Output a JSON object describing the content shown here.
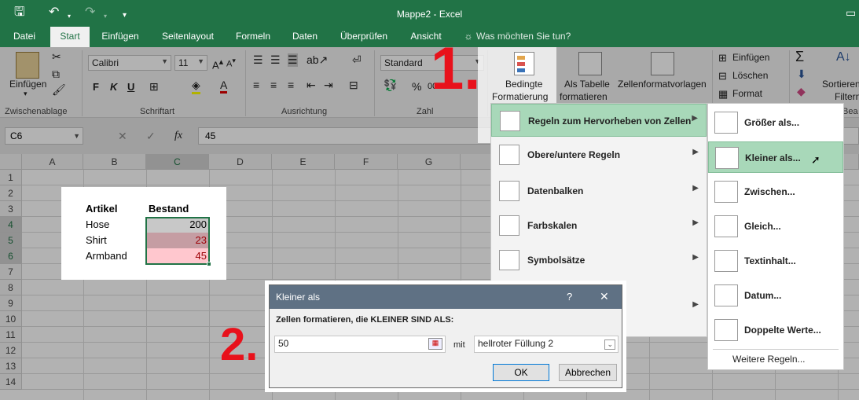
{
  "titlebar": {
    "title": "Mappe2 - Excel"
  },
  "tabs": [
    "Datei",
    "Start",
    "Einfügen",
    "Seitenlayout",
    "Formeln",
    "Daten",
    "Überprüfen",
    "Ansicht"
  ],
  "tell_me": "Was möchten Sie tun?",
  "clipboard": {
    "paste": "Einfügen",
    "label": "Zwischenablage"
  },
  "font": {
    "name": "Calibri",
    "size": "11",
    "bold": "F",
    "italic": "K",
    "underline": "U",
    "label": "Schriftart"
  },
  "alignment": {
    "label": "Ausrichtung"
  },
  "number": {
    "format": "Standard",
    "percent": "%",
    "thousands": "000",
    "label": "Zahl"
  },
  "styles": {
    "conditional_line1": "Bedingte",
    "conditional_line2": "Formatierung",
    "table_line1": "Als Tabelle",
    "table_line2": "formatieren",
    "cellstyles": "Zellenformatvorlagen"
  },
  "cells": {
    "insert": "Einfügen",
    "delete": "Löschen",
    "format": "Format"
  },
  "editing": {
    "sort_line1": "Sortieren",
    "sort_line2": "Filtern",
    "label": "Bea"
  },
  "formula": {
    "cell_ref": "C6",
    "fx": "fx",
    "value": "45"
  },
  "columns": [
    "A",
    "B",
    "C",
    "D",
    "E",
    "F",
    "G"
  ],
  "rows": [
    "1",
    "2",
    "3",
    "4",
    "5",
    "6",
    "7",
    "8",
    "9",
    "10",
    "11",
    "12",
    "13",
    "14"
  ],
  "table": {
    "header_article": "Artikel",
    "header_stock": "Bestand",
    "rows": [
      {
        "article": "Hose",
        "stock": "200"
      },
      {
        "article": "Shirt",
        "stock": "23"
      },
      {
        "article": "Armband",
        "stock": "45"
      }
    ]
  },
  "menu1": {
    "items": [
      "Regeln zum Hervorheben von Zellen",
      "Obere/untere Regeln",
      "Datenbalken",
      "Farbskalen",
      "Symbolsätze"
    ]
  },
  "menu2": {
    "items": [
      "Größer als...",
      "Kleiner als...",
      "Zwischen...",
      "Gleich...",
      "Textinhalt...",
      "Datum...",
      "Doppelte Werte..."
    ],
    "more": "Weitere Regeln..."
  },
  "dialog": {
    "title": "Kleiner als",
    "help": "?",
    "close": "✕",
    "prompt": "Zellen formatieren, die KLEINER SIND ALS:",
    "value": "50",
    "with": "mit",
    "format": "hellroter Füllung 2",
    "ok": "OK",
    "cancel": "Abbrechen"
  },
  "annotations": {
    "step1": "1.",
    "step2": "2."
  },
  "colors": {
    "excel_green": "#217346",
    "highlight_green": "#a8d8b9",
    "light_red": "#ffc7ce",
    "red_text": "#9c0006",
    "annotation_red": "#e8111b"
  }
}
